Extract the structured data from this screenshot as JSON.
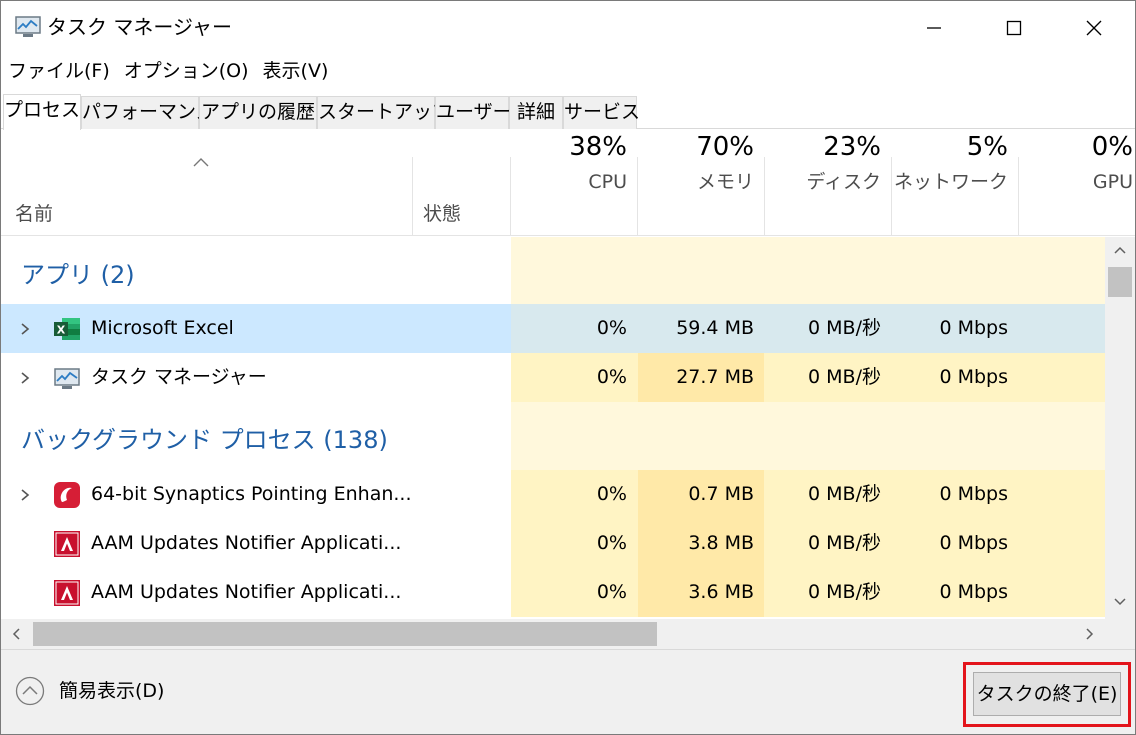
{
  "window": {
    "title": "タスク マネージャー"
  },
  "menu": [
    "ファイル(F)",
    "オプション(O)",
    "表示(V)"
  ],
  "tabs": [
    {
      "label": "プロセス",
      "active": true
    },
    {
      "label": "パフォーマンス",
      "active": false
    },
    {
      "label": "アプリの履歴",
      "active": false
    },
    {
      "label": "スタートアップ",
      "active": false
    },
    {
      "label": "ユーザー",
      "active": false
    },
    {
      "label": "詳細",
      "active": false
    },
    {
      "label": "サービス",
      "active": false
    }
  ],
  "columns": {
    "name": "名前",
    "state": "状態",
    "cpu": {
      "pct": "38%",
      "label": "CPU"
    },
    "memory": {
      "pct": "70%",
      "label": "メモリ"
    },
    "disk": {
      "pct": "23%",
      "label": "ディスク"
    },
    "network": {
      "pct": "5%",
      "label": "ネットワーク"
    },
    "gpu": {
      "pct": "0%",
      "label": "GPU"
    }
  },
  "groups": {
    "apps": "アプリ (2)",
    "background": "バックグラウンド プロセス (138)"
  },
  "rows": [
    {
      "name": "Microsoft Excel",
      "cpu": "0%",
      "memory": "59.4 MB",
      "disk": "0 MB/秒",
      "network": "0 Mbps",
      "icon": "excel-icon"
    },
    {
      "name": "タスク マネージャー",
      "cpu": "0%",
      "memory": "27.7 MB",
      "disk": "0 MB/秒",
      "network": "0 Mbps",
      "icon": "task-manager-icon"
    },
    {
      "name": "64-bit Synaptics Pointing Enhan...",
      "cpu": "0%",
      "memory": "0.7 MB",
      "disk": "0 MB/秒",
      "network": "0 Mbps",
      "icon": "synaptics-icon"
    },
    {
      "name": "AAM Updates Notifier Applicati...",
      "cpu": "0%",
      "memory": "3.8 MB",
      "disk": "0 MB/秒",
      "network": "0 Mbps",
      "icon": "adobe-icon"
    },
    {
      "name": "AAM Updates Notifier Applicati...",
      "cpu": "0%",
      "memory": "3.6 MB",
      "disk": "0 MB/秒",
      "network": "0 Mbps",
      "icon": "adobe-icon"
    }
  ],
  "footer": {
    "simple_view": "簡易表示(D)",
    "end_task": "タスクの終了(E)"
  },
  "colors": {
    "heat_light": "#fff4c4",
    "heat_medium": "#ffe9a8",
    "selected": "#cce8ff",
    "group_text": "#1f5fa6",
    "highlight": "#e3141b"
  }
}
